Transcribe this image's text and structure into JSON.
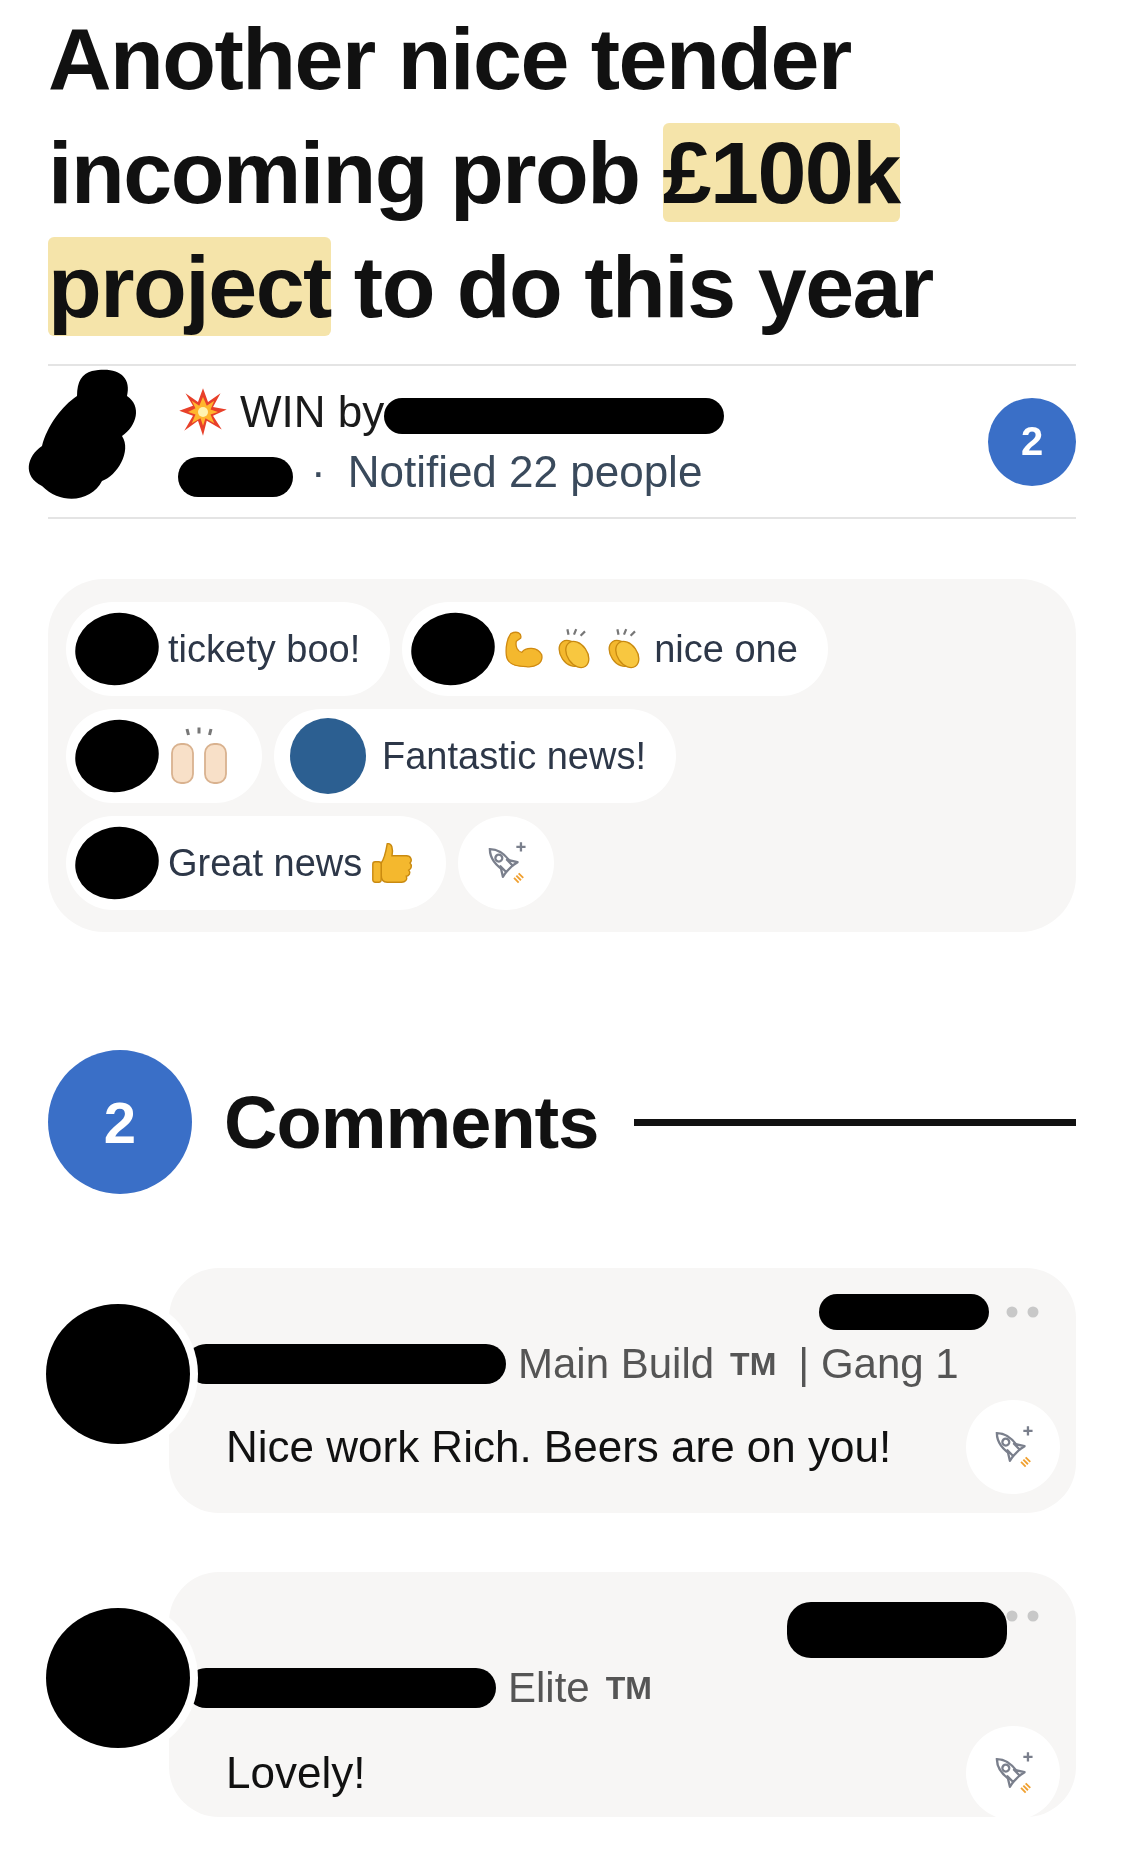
{
  "post": {
    "title": {
      "text_before": "Another nice tender incoming prob ",
      "highlighted": "£100k project",
      "text_after": " to do this year"
    }
  },
  "win": {
    "label": "WIN by",
    "separator": "·",
    "notified": "Notified 22 people",
    "count": "2"
  },
  "reactions": [
    {
      "avatar": {
        "kind": "redacted"
      },
      "text": "tickety boo!"
    },
    {
      "avatar": {
        "kind": "redacted"
      },
      "icons_before": [
        {
          "kind": "muscle"
        },
        {
          "kind": "clap"
        },
        {
          "kind": "clap"
        }
      ],
      "text": "nice one"
    },
    {
      "avatar": {
        "kind": "redacted"
      },
      "icons_before": [
        {
          "kind": "raised-hands"
        }
      ]
    },
    {
      "avatar": {
        "kind": "plain"
      },
      "text": "Fantastic news!"
    },
    {
      "avatar": {
        "kind": "redacted"
      },
      "text": "Great news",
      "icons_after": [
        {
          "kind": "thumbs-up"
        }
      ]
    }
  ],
  "comments_header": {
    "count": "2",
    "title": "Comments"
  },
  "comments": [
    {
      "author": "Main Build",
      "badge": "TM",
      "team": "| Gang 1",
      "text": "Nice work Rich. Beers are on you!"
    },
    {
      "author": "Elite",
      "badge": "TM",
      "text": "Lovely!"
    }
  ]
}
